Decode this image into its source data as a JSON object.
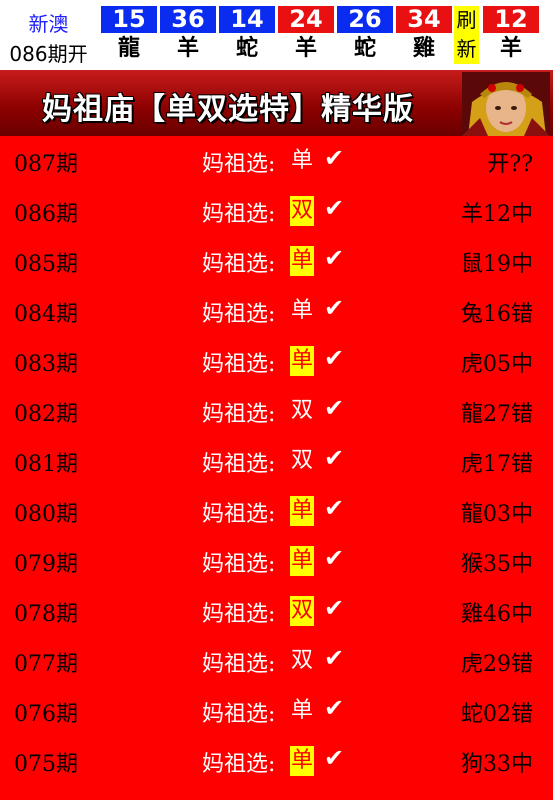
{
  "header": {
    "brand_line1": "新澳",
    "brand_line2": "086期开",
    "refresh_label": "刷新",
    "balls": [
      {
        "number": "15",
        "zodiac": "龍",
        "color": "#0a2cf0"
      },
      {
        "number": "36",
        "zodiac": "羊",
        "color": "#0a2cf0"
      },
      {
        "number": "14",
        "zodiac": "蛇",
        "color": "#0a2cf0"
      },
      {
        "number": "24",
        "zodiac": "羊",
        "color": "#e81010"
      },
      {
        "number": "26",
        "zodiac": "蛇",
        "color": "#0a2cf0"
      },
      {
        "number": "34",
        "zodiac": "雞",
        "color": "#e81010"
      },
      {
        "number": "12",
        "zodiac": "羊",
        "color": "#e81010"
      }
    ]
  },
  "banner": {
    "title": "妈祖庙【单双选特】精华版"
  },
  "rows": [
    {
      "period": "087期",
      "prefix": "妈祖选:",
      "pick": "单",
      "highlight": false,
      "check": "✔",
      "result": "开??"
    },
    {
      "period": "086期",
      "prefix": "妈祖选:",
      "pick": "双",
      "highlight": true,
      "check": "✔",
      "result": "羊12中"
    },
    {
      "period": "085期",
      "prefix": "妈祖选:",
      "pick": "单",
      "highlight": true,
      "check": "✔",
      "result": "鼠19中"
    },
    {
      "period": "084期",
      "prefix": "妈祖选:",
      "pick": "单",
      "highlight": false,
      "check": "✔",
      "result": "兔16错"
    },
    {
      "period": "083期",
      "prefix": "妈祖选:",
      "pick": "单",
      "highlight": true,
      "check": "✔",
      "result": "虎05中"
    },
    {
      "period": "082期",
      "prefix": "妈祖选:",
      "pick": "双",
      "highlight": false,
      "check": "✔",
      "result": "龍27错"
    },
    {
      "period": "081期",
      "prefix": "妈祖选:",
      "pick": "双",
      "highlight": false,
      "check": "✔",
      "result": "虎17错"
    },
    {
      "period": "080期",
      "prefix": "妈祖选:",
      "pick": "单",
      "highlight": true,
      "check": "✔",
      "result": "龍03中"
    },
    {
      "period": "079期",
      "prefix": "妈祖选:",
      "pick": "单",
      "highlight": true,
      "check": "✔",
      "result": "猴35中"
    },
    {
      "period": "078期",
      "prefix": "妈祖选:",
      "pick": "双",
      "highlight": true,
      "check": "✔",
      "result": "雞46中"
    },
    {
      "period": "077期",
      "prefix": "妈祖选:",
      "pick": "双",
      "highlight": false,
      "check": "✔",
      "result": "虎29错"
    },
    {
      "period": "076期",
      "prefix": "妈祖选:",
      "pick": "单",
      "highlight": false,
      "check": "✔",
      "result": "蛇02错"
    },
    {
      "period": "075期",
      "prefix": "妈祖选:",
      "pick": "单",
      "highlight": true,
      "check": "✔",
      "result": "狗33中"
    }
  ]
}
